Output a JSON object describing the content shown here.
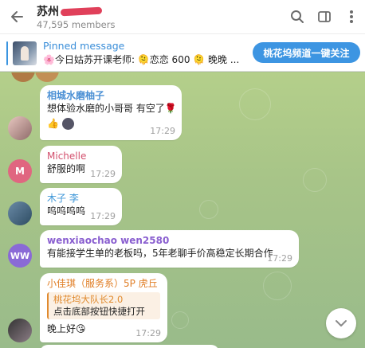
{
  "header": {
    "title": "苏州",
    "members": "47,595 members"
  },
  "pinned": {
    "title": "Pinned message",
    "body": "🌸今日姑苏开课老师: 🫠恋恋 600 🫠 晚晚 ...",
    "button": "桃花坞频道一键关注"
  },
  "messages": [
    {
      "name": "相城水磨柚子",
      "name_color": "#4a8fd4",
      "text": "想体验水磨的小哥哥  有空了🌹",
      "extra": "👍",
      "time": "17:29"
    },
    {
      "name": "Michelle",
      "name_color": "#d3506e",
      "avatar_letter": "M",
      "avatar_color": "#e06680",
      "text": "舒服的啊",
      "time": "17:29"
    },
    {
      "name": "木子 李",
      "name_color": "#3d96d8",
      "text": "呜呜呜呜",
      "time": "17:29"
    },
    {
      "name": "wenxiaochao wen2580",
      "name_color": "#8a5fd0",
      "avatar_letter": "WW",
      "avatar_color": "#8a6ad6",
      "text": "有能接学生单的老板吗，5年老聊手价高稳定长期合作",
      "time": "17:29"
    },
    {
      "name": "小佳琪（服务系）5P 虎丘",
      "name_color": "#e07d24",
      "reply_name": "桃花坞大队长2.0",
      "reply_text": "点击底部按钮快捷打开",
      "text": "晚上好😘",
      "time": "17:29"
    }
  ],
  "colors": {
    "accent": "#3d95e2"
  }
}
